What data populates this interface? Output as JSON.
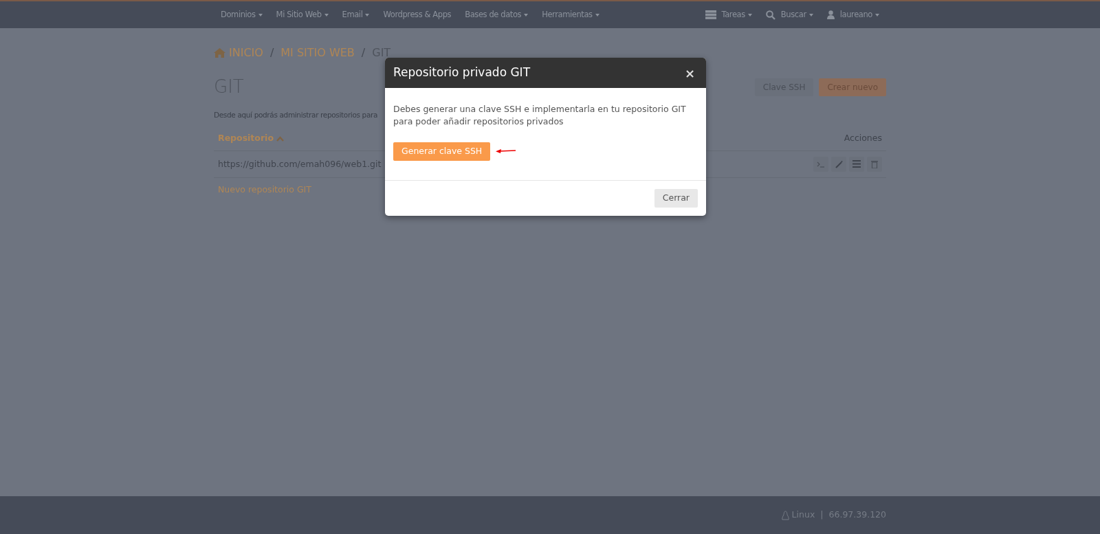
{
  "navbar": {
    "menus": [
      {
        "label": "Dominios",
        "dropdown": true
      },
      {
        "label": "Mi Sitio Web",
        "dropdown": true
      },
      {
        "label": "Email",
        "dropdown": true
      },
      {
        "label": "Wordpress & Apps",
        "dropdown": false
      },
      {
        "label": "Bases de datos",
        "dropdown": true
      },
      {
        "label": "Herramientas",
        "dropdown": true
      }
    ],
    "right_menus": [
      {
        "kind": "tasks",
        "label": "Tareas"
      },
      {
        "kind": "search",
        "label": "Buscar"
      },
      {
        "kind": "user",
        "label": "laureano"
      }
    ]
  },
  "breadcrumb": [
    {
      "label": "INICIO",
      "kind": "home"
    },
    {
      "label": "MI SITIO WEB",
      "kind": "link"
    },
    {
      "label": "GIT",
      "kind": "current"
    }
  ],
  "breadcrumb_separators": [
    "/",
    "/"
  ],
  "page": {
    "title": "GIT",
    "description": "Desde aquí podrás administrar repositorios para",
    "buttons": [
      {
        "label": "Clave SSH",
        "kind": "secondary"
      },
      {
        "label": "Crear nuevo",
        "kind": "primary"
      }
    ]
  },
  "table": {
    "columns": [
      {
        "label": "Repositorio",
        "sorted": true
      },
      {
        "label": "Acciones",
        "sorted": false
      }
    ],
    "rows": [
      {
        "repository": "https://github.com/emah096/web1.git",
        "actions": [
          {
            "kind": "terminal"
          },
          {
            "kind": "edit"
          },
          {
            "kind": "list"
          },
          {
            "kind": "delete"
          }
        ]
      }
    ],
    "new_link": "Nuevo repositorio GIT"
  },
  "modal": {
    "title": "Repositorio privado GIT",
    "close": "×",
    "message": "Debes generar una clave SSH e implementarla en tu repositorio GIT para poder añadir repositorios privados",
    "action": "Generar clave SSH",
    "footer_button": "Cerrar"
  },
  "footer": {
    "os": "Linux",
    "separator": "|",
    "ip": "66.97.39.120"
  }
}
